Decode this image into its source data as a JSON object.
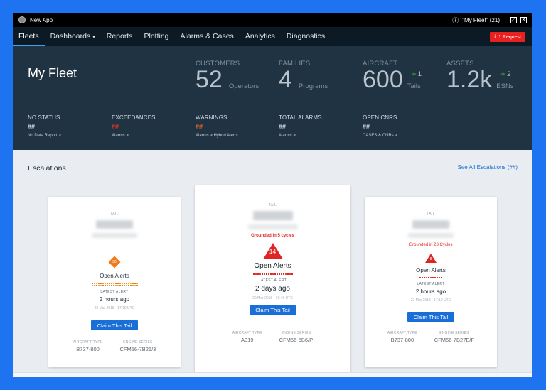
{
  "titlebar": {
    "app_title": "New App",
    "fleet_selector": "\"My Fleet\" (21)"
  },
  "nav": {
    "items": [
      {
        "label": "Fleets"
      },
      {
        "label": "Dashboards"
      },
      {
        "label": "Reports"
      },
      {
        "label": "Plotting"
      },
      {
        "label": "Alarms & Cases"
      },
      {
        "label": "Analytics"
      },
      {
        "label": "Diagnostics"
      }
    ],
    "request_label": "1 Request"
  },
  "fleet": {
    "title": "My Fleet",
    "stats": {
      "customers": {
        "label": "CUSTOMERS",
        "value": "52",
        "unit": "Operators"
      },
      "families": {
        "label": "FAMILIES",
        "value": "4",
        "unit": "Programs"
      },
      "aircraft": {
        "label": "AIRCRAFT",
        "value": "600",
        "delta": "+",
        "delta_value": "1",
        "unit": "Tails"
      },
      "assets": {
        "label": "ASSETS",
        "value": "1.2k",
        "delta": "+",
        "delta_value": "2",
        "unit": "ESNs"
      }
    },
    "metrics": [
      {
        "label": "NO STATUS",
        "value": "##",
        "link": "No Data Report >"
      },
      {
        "label": "EXCEEDANCES",
        "value": "##",
        "link": "Alarms >"
      },
      {
        "label": "WARNINGS",
        "value": "##",
        "link": "Alarms > Hybrid Alerts"
      },
      {
        "label": "TOTAL ALARMS",
        "value": "##",
        "link": "Alarms >"
      },
      {
        "label": "OPEN CNRS",
        "value": "##",
        "link": "CASES & CNRs >"
      }
    ]
  },
  "escalations": {
    "title": "Escalations",
    "see_all": "See All Escalations (##)",
    "cards": [
      {
        "tail_label": "TAIL",
        "grounded": "",
        "badge_count": "30",
        "badge_shape": "diamond",
        "open_alerts": "Open Alerts",
        "latest_label": "LATEST ALERT",
        "latest_time": "2 hours ago",
        "latest_date": "22 Mar 2018 - 17:10 UTC",
        "claim_label": "Claim This Tail",
        "aircraft_type_label": "AIRCRAFT TYPE",
        "aircraft_type": "B737-800",
        "engine_series_label": "ENGINE SERIES",
        "engine_series": "CFM56-7B26/3"
      },
      {
        "tail_label": "TAIL",
        "grounded": "Grounded in 5 cycles",
        "badge_count": "14",
        "badge_shape": "triangle",
        "open_alerts": "Open Alerts",
        "latest_label": "LATEST ALERT",
        "latest_time": "2 days ago",
        "latest_date": "20 Mar 2018 - 16:46 UTC",
        "claim_label": "Claim This Tail",
        "aircraft_type_label": "AIRCRAFT TYPE",
        "aircraft_type": "A319",
        "engine_series_label": "ENGINE SERIES",
        "engine_series": "CFM56-5B6/P"
      },
      {
        "tail_label": "TAIL",
        "grounded": "Grounded in 23 Cycles",
        "badge_count": "8",
        "badge_shape": "triangle",
        "open_alerts": "Open Alerts",
        "latest_label": "LATEST ALERT",
        "latest_time": "2 hours ago",
        "latest_date": "22 Mar 2018 - 17:10 UTC",
        "claim_label": "Claim This Tail",
        "aircraft_type_label": "AIRCRAFT TYPE",
        "aircraft_type": "B737-800",
        "engine_series_label": "ENGINE SERIES",
        "engine_series": "CFM56-7B27E/F"
      }
    ]
  },
  "colors": {
    "brand_blue": "#1a6ed8",
    "request_red": "#e82020",
    "header_bg": "#203342",
    "nav_bg": "#0b1a24",
    "warning_orange": "#f07a1a",
    "alert_red": "#e02525",
    "delta_green": "#3dba3d"
  }
}
